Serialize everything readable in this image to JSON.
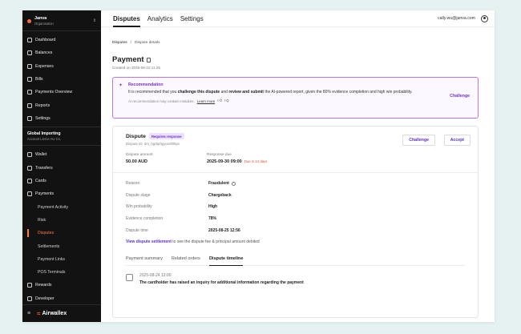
{
  "org": {
    "name": "Janva",
    "subtitle": "Organisation"
  },
  "nav_top": [
    {
      "label": "Dashboard",
      "icon": "dashboard-icon"
    },
    {
      "label": "Balances",
      "icon": "balances-icon"
    },
    {
      "label": "Expenses",
      "icon": "expenses-icon"
    },
    {
      "label": "Bills",
      "icon": "bills-icon"
    },
    {
      "label": "Payments Overview",
      "icon": "payments-overview-icon"
    },
    {
      "label": "Reports",
      "icon": "reports-icon"
    },
    {
      "label": "Settings",
      "icon": "settings-icon"
    }
  ],
  "section": {
    "title": "Global Importing",
    "subtitle": "Account Lierce AU Co."
  },
  "nav_mid": [
    {
      "label": "Wallet",
      "icon": "wallet-icon"
    },
    {
      "label": "Transfers",
      "icon": "transfers-icon"
    },
    {
      "label": "Cards",
      "icon": "cards-icon"
    },
    {
      "label": "Payments",
      "icon": "payments-icon"
    }
  ],
  "nav_sub": [
    {
      "label": "Payment Activity"
    },
    {
      "label": "Risk"
    },
    {
      "label": "Disputes"
    },
    {
      "label": "Settlements"
    },
    {
      "label": "Payment Links"
    },
    {
      "label": "POS Terminals"
    }
  ],
  "nav_bottom": [
    {
      "label": "Rewards",
      "icon": "rewards-icon"
    },
    {
      "label": "Developer",
      "icon": "developer-icon"
    }
  ],
  "brand": {
    "name": "Airwallex",
    "hamburger": "≡",
    "mark": "≈"
  },
  "topbar": {
    "tabs": [
      "Disputes",
      "Analytics",
      "Settings"
    ],
    "email": "cally.wu@janva.com"
  },
  "breadcrumb": {
    "root": "Disputes",
    "sep": "/",
    "current": "Dispute details"
  },
  "page": {
    "title": "Payment",
    "created": "Created on 2025-08-22 11:25"
  },
  "recommendation": {
    "title": "Recommendation",
    "text_1": "It is recommended that you ",
    "text_b1": "challenge this dispute",
    "text_2": " and ",
    "text_b2": "review and submit",
    "text_3": " the AI-powered report, given the 80% evidence completion and high win probability.",
    "disclaimer": "AI recommendation may contain mistakes.",
    "learn_more": "Learn more",
    "action": "Challenge"
  },
  "dispute": {
    "title": "Dispute",
    "badge": "Requires response",
    "id": "Dispute ID: dst_hgrbphgyuvd0l8pv",
    "challenge": "Challenge",
    "accept": "Accept",
    "amount_label": "Dispute amount",
    "amount": "50.00 AUD",
    "due_label": "Response due",
    "due": "2025-09-30 09:00",
    "due_note": "Due in 14 days",
    "details": [
      {
        "label": "Reason",
        "value": "Fraudulent"
      },
      {
        "label": "Dispute stage",
        "value": "Chargeback"
      },
      {
        "label": "Win probability",
        "value": "High"
      },
      {
        "label": "Evidence completion",
        "value": "78%"
      },
      {
        "label": "Dispute time",
        "value": "2025-08-25 12:56"
      }
    ],
    "settlement_link": "View dispute settlement",
    "settlement_text": " to see the dispute fee & principal amount debited",
    "tabs": [
      "Payment summary",
      "Related orders",
      "Dispute timeline"
    ],
    "timeline_date": "2025-08-24 12:00",
    "timeline_text": "The cardholder has raised an inquiry for additional information regarding the payment"
  },
  "colors": {
    "accent": "#7b2fd6",
    "brand": "#ff5a2c",
    "sidebar": "#121212",
    "due": "#e0522e"
  }
}
